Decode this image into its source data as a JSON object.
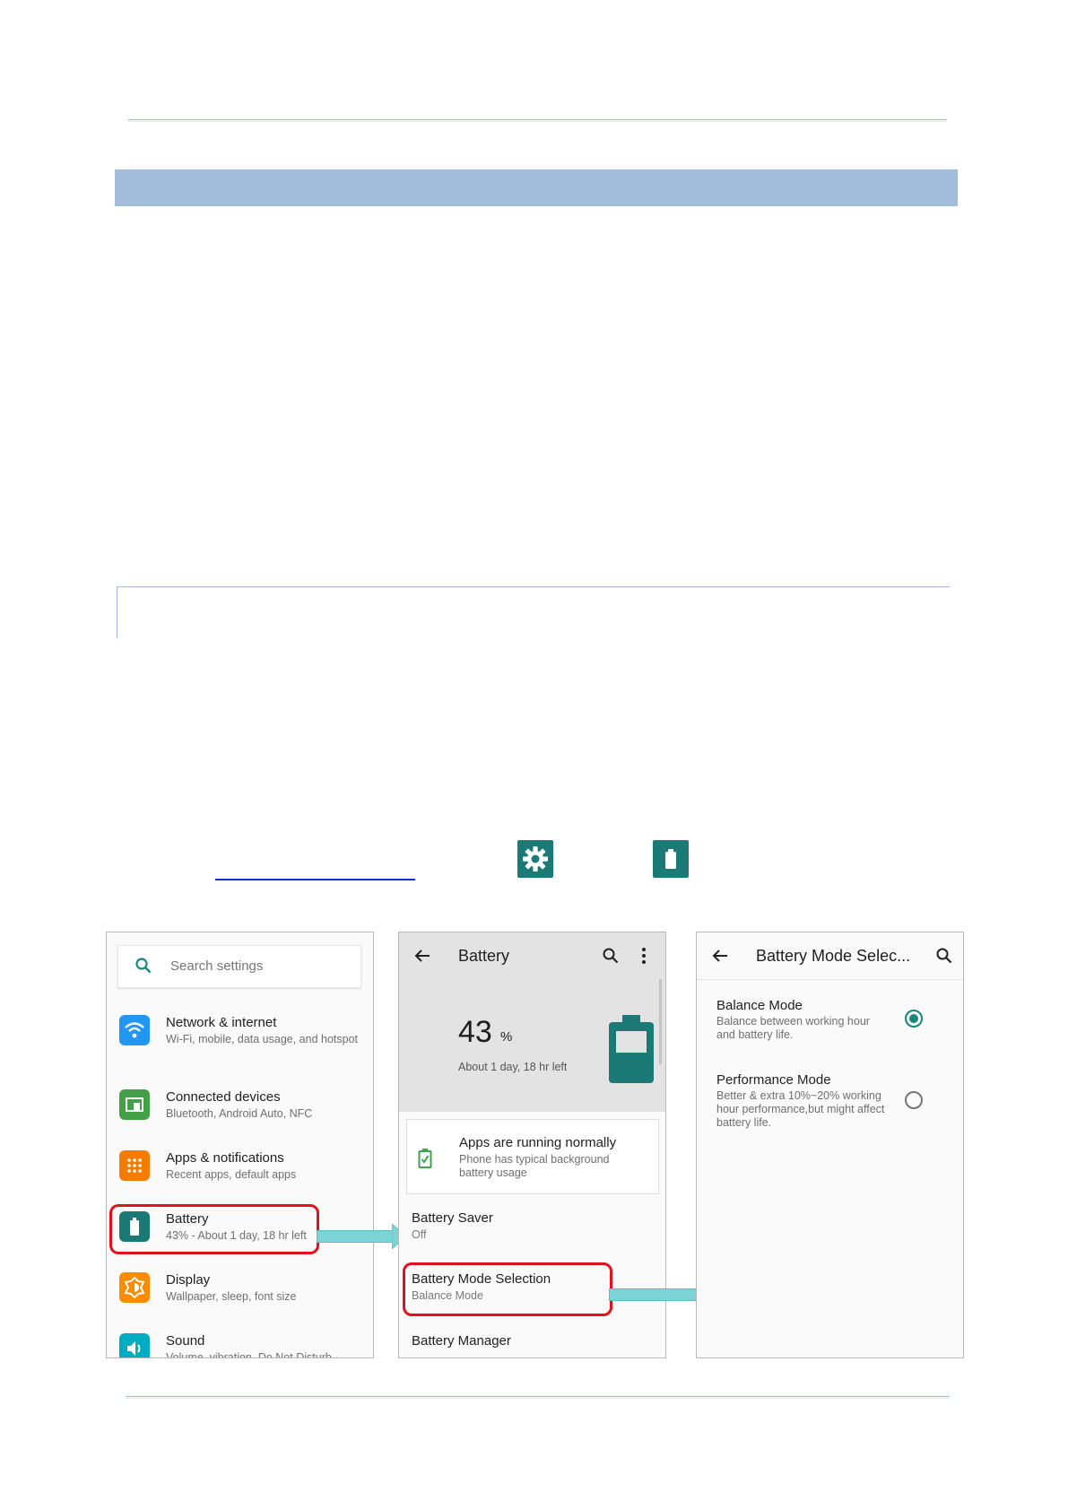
{
  "colors": {
    "band": "#a2bddb",
    "rule": "#9fb8d6",
    "teal": "#1b7a75",
    "highlight": "#e2121c",
    "arrow": "#7dd4d4",
    "link": "#1a2ad8"
  },
  "inline_icons": {
    "settings": "gear-icon",
    "battery": "battery-icon"
  },
  "screen1": {
    "search_placeholder": "Search settings",
    "items": [
      {
        "title": "Network & internet",
        "sub": "Wi-Fi, mobile, data usage, and hotspot",
        "icon": "wifi-icon",
        "color": "#2196f3"
      },
      {
        "title": "Connected devices",
        "sub": "Bluetooth, Android Auto, NFC",
        "icon": "devices-icon",
        "color": "#43a047"
      },
      {
        "title": "Apps & notifications",
        "sub": "Recent apps, default apps",
        "icon": "apps-grid-icon",
        "color": "#f57c00"
      },
      {
        "title": "Battery",
        "sub": "43% - About 1 day, 18 hr left",
        "icon": "battery-icon",
        "color": "#1b7a75"
      },
      {
        "title": "Display",
        "sub": "Wallpaper, sleep, font size",
        "icon": "brightness-icon",
        "color": "#fb8c00"
      },
      {
        "title": "Sound",
        "sub": "Volume, vibration, Do Not Disturb",
        "icon": "volume-icon",
        "color": "#00acc1"
      }
    ]
  },
  "screen2": {
    "title": "Battery",
    "percent": "43",
    "percent_sign": "%",
    "time_left": "About 1 day, 18 hr left",
    "status_title": "Apps are running normally",
    "status_sub": "Phone has typical background battery usage",
    "saver_title": "Battery Saver",
    "saver_sub": "Off",
    "mode_title": "Battery Mode Selection",
    "mode_sub": "Balance Mode",
    "manager_title": "Battery Manager"
  },
  "screen3": {
    "title": "Battery Mode Selec...",
    "modes": [
      {
        "title": "Balance Mode",
        "sub": "Balance between working hour and battery life.",
        "selected": true
      },
      {
        "title": "Performance Mode",
        "sub": "Better & extra 10%~20% working hour performance,but might affect battery life.",
        "selected": false
      }
    ]
  }
}
